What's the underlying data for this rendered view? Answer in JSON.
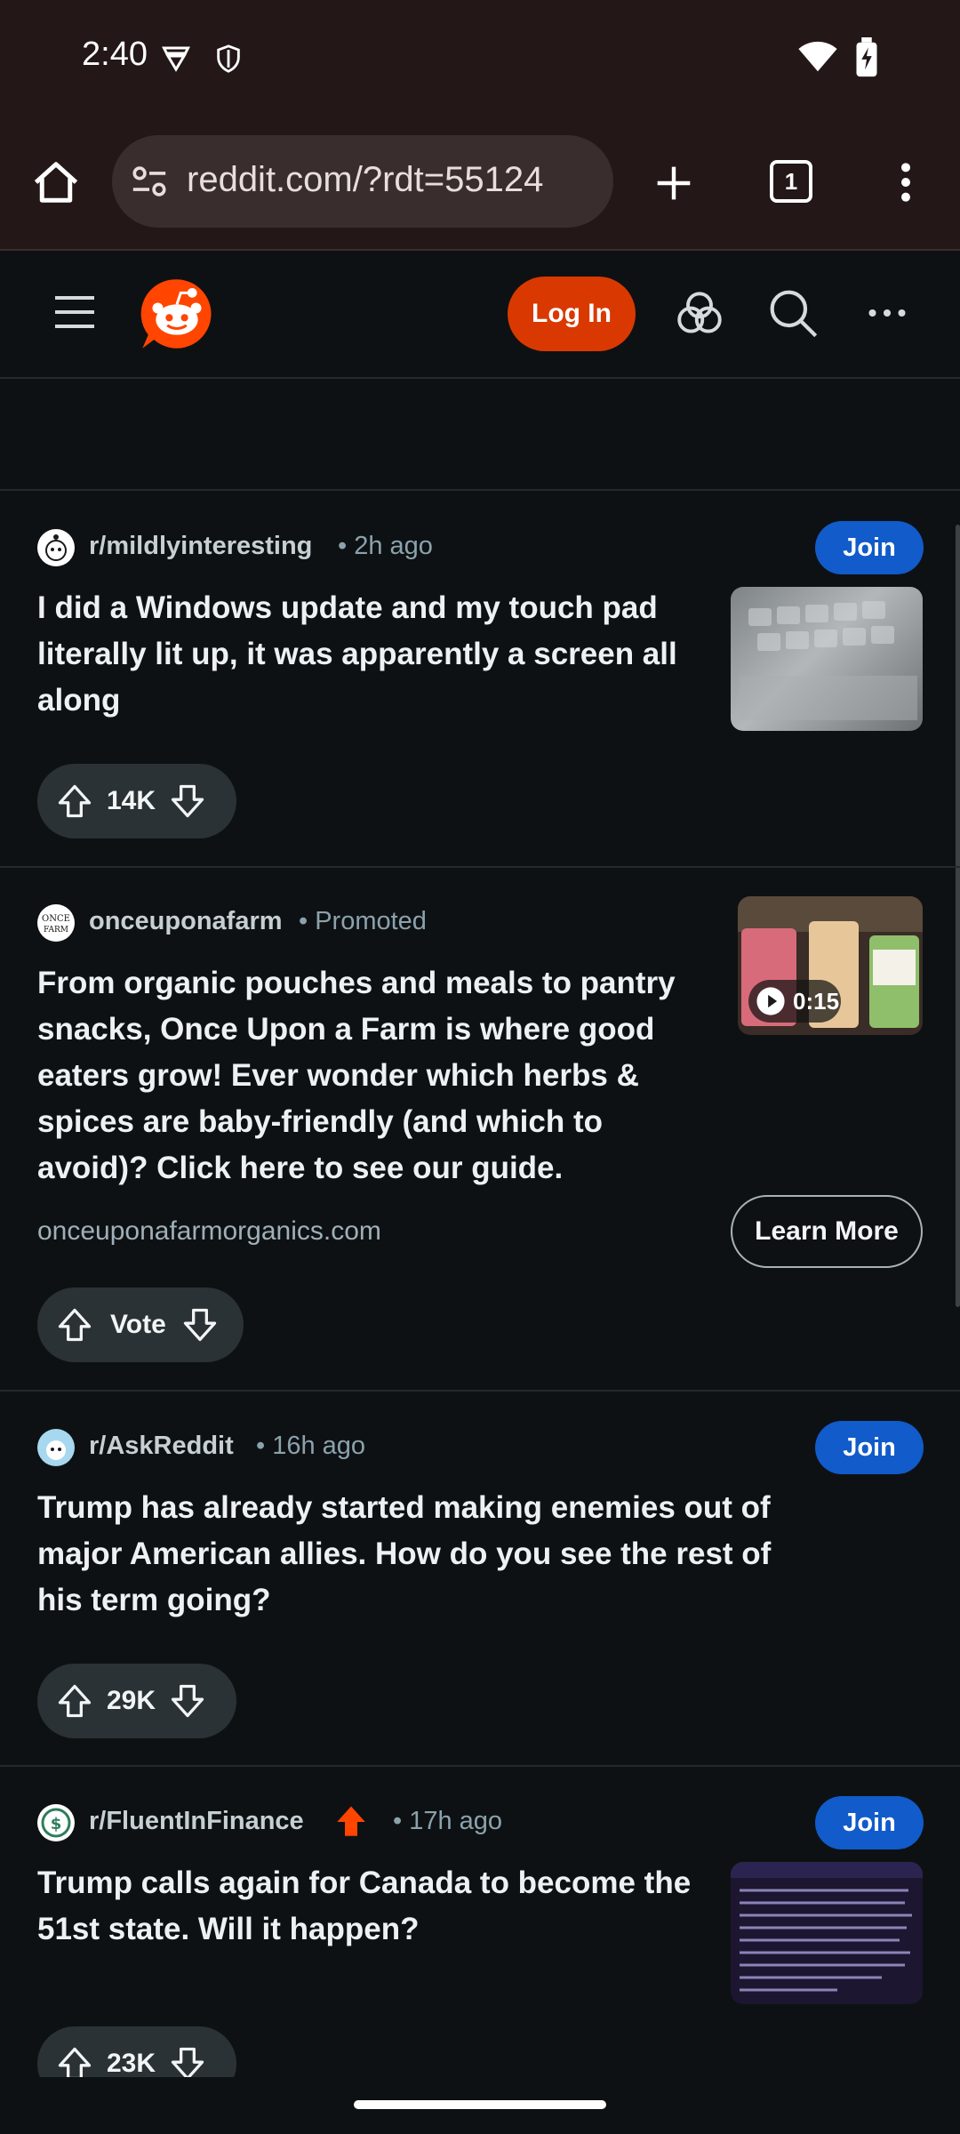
{
  "status_bar": {
    "time": "2:40"
  },
  "browser": {
    "url": "reddit.com/?rdt=55124",
    "tab_count": "1"
  },
  "header": {
    "login_label": "Log In"
  },
  "posts": [
    {
      "subreddit": "r/mildlyinteresting",
      "time": "• 2h ago",
      "title": "I did a Windows update and my touch pad literally lit up, it was apparently a screen all along",
      "join_label": "Join",
      "votes": "14K"
    },
    {
      "advertiser": "onceuponafarm",
      "tag": "• Promoted",
      "title": "From organic pouches and meals to pantry snacks, Once Upon a Farm is where good eaters grow! Ever wonder which herbs & spices are baby-friendly (and which to avoid)? Click here to see our guide.",
      "domain": "onceuponafarmorganics.com",
      "cta_label": "Learn More",
      "vote_label": "Vote",
      "video_duration": "0:15"
    },
    {
      "subreddit": "r/AskReddit",
      "time": "• 16h ago",
      "title": "Trump has already started making enemies out of major American allies. How do you see the rest of his term going?",
      "join_label": "Join",
      "votes": "29K"
    },
    {
      "subreddit": "r/FluentInFinance",
      "time": "• 17h ago",
      "title": "Trump calls again for Canada to become the 51st state. Will it happen?",
      "join_label": "Join",
      "votes": "23K"
    }
  ],
  "colors": {
    "background": "#0e1113",
    "login_orange": "#d93900",
    "join_blue": "#115bca",
    "reddit_orange": "#ff4500",
    "browser_chrome": "#241718"
  },
  "icons": [
    "home-icon",
    "site-settings-icon",
    "new-tab-icon",
    "tab-switcher-icon",
    "overflow-menu-icon",
    "hamburger-menu-icon",
    "reddit-logo",
    "advertise-icon",
    "search-icon",
    "more-icon",
    "upvote-icon",
    "downvote-icon",
    "play-icon",
    "wifi-icon",
    "battery-icon"
  ]
}
